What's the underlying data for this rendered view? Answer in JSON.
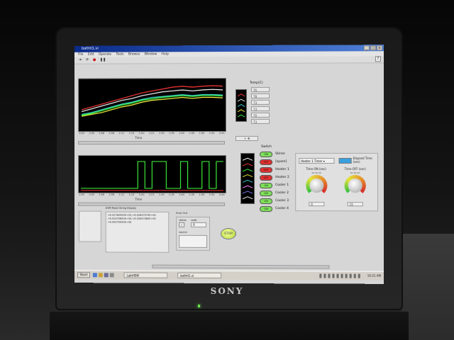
{
  "window": {
    "title": "bathtl1.vi",
    "controls": [
      "_",
      "□",
      "×"
    ]
  },
  "menu": [
    "File",
    "Edit",
    "Operate",
    "Tools",
    "Browse",
    "Window",
    "Help"
  ],
  "chart_data": [
    {
      "type": "line",
      "title": "",
      "xlabel": "Time",
      "ylabel": "",
      "x_ticks": [
        "1:00",
        "1:00",
        "1:06",
        "1:06",
        "1:11",
        "1:15",
        "1:20",
        "1:21",
        "1:30",
        "1:35",
        "1:40",
        "1:45",
        "1:50",
        "1:55",
        "2:00"
      ],
      "series": [
        {
          "color": "#ff3a3a",
          "values": [
            40,
            46,
            52,
            58,
            64,
            70,
            76,
            80,
            84,
            88,
            90,
            88,
            90,
            91,
            90
          ]
        },
        {
          "color": "#ffffff",
          "values": [
            36,
            42,
            48,
            54,
            60,
            64,
            70,
            74,
            78,
            80,
            82,
            80,
            82,
            83,
            82
          ]
        },
        {
          "color": "#3fe0e0",
          "values": [
            30,
            34,
            40,
            46,
            52,
            56,
            62,
            66,
            68,
            70,
            72,
            70,
            72,
            72,
            71
          ]
        },
        {
          "color": "#ffff40",
          "values": [
            26,
            30,
            34,
            40,
            46,
            50,
            56,
            60,
            62,
            64,
            66,
            64,
            66,
            66,
            65
          ]
        },
        {
          "color": "#40ff40",
          "values": [
            28,
            32,
            38,
            44,
            50,
            54,
            60,
            63,
            66,
            68,
            70,
            68,
            70,
            70,
            69
          ]
        }
      ],
      "ylim": [
        0,
        100
      ],
      "grid": false
    },
    {
      "type": "line",
      "title": "",
      "xlabel": "Time",
      "series": [
        {
          "color": "#ff3a3a",
          "name": "heater",
          "values": [
            0,
            0,
            0,
            0,
            0,
            0,
            0,
            0,
            0,
            0,
            0,
            0,
            0,
            0,
            0,
            0,
            0,
            0,
            0,
            0
          ]
        },
        {
          "color": "#40ff40",
          "name": "switch",
          "values": [
            0,
            0,
            0,
            0,
            0,
            0,
            0,
            0,
            1,
            0,
            1,
            1,
            0,
            0,
            1,
            0,
            0,
            1,
            0,
            1
          ]
        }
      ],
      "ylim": [
        0,
        1
      ]
    }
  ],
  "temp": {
    "label": "Temp(C)",
    "values": [
      "76",
      "78",
      "73",
      "73",
      "70",
      "73"
    ]
  },
  "palette_label": "",
  "switch": {
    "title": "Switch",
    "items": [
      {
        "label": "Stirrer",
        "state": "on",
        "color": "#7ee05a",
        "led_text": "ON"
      },
      {
        "label": "[spare]",
        "state": "off",
        "color": "#e03030",
        "led_text": "OFF"
      },
      {
        "label": "Heater 1",
        "state": "off",
        "color": "#e03030",
        "led_text": "OFF"
      },
      {
        "label": "Heater 2",
        "state": "off",
        "color": "#e03030",
        "led_text": "OFF"
      },
      {
        "label": "Cooler 1",
        "state": "on",
        "color": "#7ee05a",
        "led_text": "ON"
      },
      {
        "label": "Cooler 2",
        "state": "on",
        "color": "#7ee05a",
        "led_text": "ON"
      },
      {
        "label": "Cooler 3",
        "state": "on",
        "color": "#7ee05a",
        "led_text": "ON"
      },
      {
        "label": "Cooler 4",
        "state": "on",
        "color": "#7ee05a",
        "led_text": "ON"
      }
    ]
  },
  "heater_panel": {
    "dropdown_value": "Heater 1 Timer",
    "elapsed_label": "Elapsed Time (sec)",
    "dial_on": {
      "label": "Time ON (sec)",
      "scale": "20 30 40",
      "value": "0"
    },
    "dial_off": {
      "label": "Time OFF (sec)",
      "scale": "20 30 40",
      "value": "15"
    }
  },
  "bottom": {
    "drive_label": "DVM Read String Display",
    "drive_lines": [
      "+6.02780000E+00,+6.02847070E+00",
      "+6.02070800E+00,+6.02847080E+00",
      "+6.00070000E+00"
    ],
    "error_out": "Error Out",
    "status_label": "status",
    "code_label": "code",
    "code_value": "0",
    "source_label": "source"
  },
  "stop_label": "STOP",
  "taskbar": {
    "start": "Start",
    "items": [
      "LabVIEW",
      "bathtl1.vi"
    ],
    "clock": "10:21 AM"
  },
  "brand": "SONY"
}
